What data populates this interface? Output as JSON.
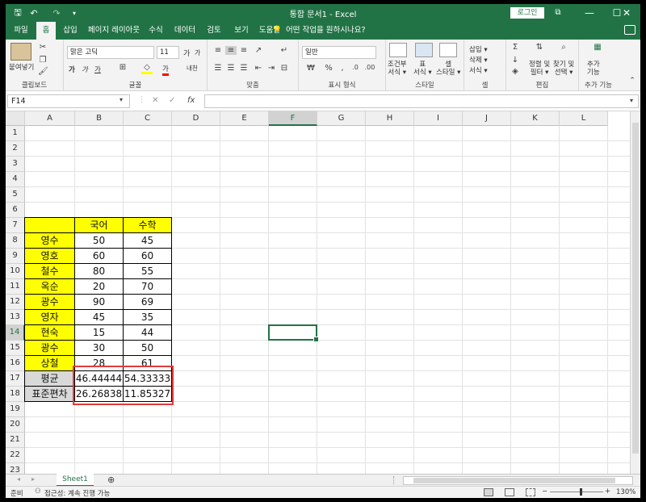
{
  "window": {
    "title": "통합 문서1  -  Excel",
    "login_label": "로그인",
    "qat_save": "🖫",
    "qat_undo": "↶",
    "qat_redo": "↷",
    "qat_more": "▾",
    "restore_icon": "⧉",
    "min_icon": "—",
    "max_icon": "☐",
    "close_icon": "✕"
  },
  "tabs": [
    "파일",
    "홈",
    "삽입",
    "페이지 레이아웃",
    "수식",
    "데이터",
    "검토",
    "보기",
    "도움말"
  ],
  "tell_me": "어떤 작업을 원하시나요?",
  "tell_me_icon": "💡",
  "ribbon": {
    "clipboard": {
      "label": "클립보드",
      "paste": "붙여넣기"
    },
    "font": {
      "label": "글꼴",
      "font_name": "맑은 고딕",
      "font_size": "11",
      "bold": "가",
      "italic": "가",
      "underline": "가",
      "grow": "가",
      "shrink": "가",
      "font_color": "가",
      "phonetic": "내천"
    },
    "alignment": {
      "label": "맞춤"
    },
    "number": {
      "label": "표시 형식",
      "format": "일반"
    },
    "styles": {
      "label": "스타일",
      "conditional": "조건부\n서식 ▾",
      "table": "표\n서식 ▾",
      "cell": "셀\n스타일 ▾"
    },
    "cells": {
      "label": "셀",
      "insert": "삽입 ▾",
      "delete": "삭제 ▾",
      "format": "서식 ▾"
    },
    "editing": {
      "label": "편집",
      "sort": "정렬 및\n필터 ▾",
      "find": "찾기 및\n선택 ▾"
    },
    "addins": {
      "label": "추가 기능",
      "addins": "추가\n기능"
    }
  },
  "formula_bar": {
    "name_box": "F14",
    "cancel": "✕",
    "enter": "✓",
    "fx": "fx",
    "formula": ""
  },
  "grid": {
    "columns": [
      "A",
      "B",
      "C",
      "D",
      "E",
      "F",
      "G",
      "H",
      "I",
      "J",
      "K",
      "L"
    ],
    "rows": [
      "1",
      "2",
      "3",
      "4",
      "5",
      "6",
      "7",
      "8",
      "9",
      "10",
      "11",
      "12",
      "13",
      "14",
      "15",
      "16",
      "17",
      "18",
      "19",
      "20",
      "21",
      "22",
      "23"
    ],
    "selected_cell": "F14",
    "table": {
      "header": [
        "",
        "국어",
        "수학"
      ],
      "students": [
        [
          "영수",
          "50",
          "45"
        ],
        [
          "영호",
          "60",
          "60"
        ],
        [
          "철수",
          "80",
          "55"
        ],
        [
          "옥순",
          "20",
          "70"
        ],
        [
          "광수",
          "90",
          "69"
        ],
        [
          "영자",
          "45",
          "35"
        ],
        [
          "현숙",
          "15",
          "44"
        ],
        [
          "광수",
          "30",
          "50"
        ],
        [
          "상철",
          "28",
          "61"
        ]
      ],
      "stats": [
        [
          "평균",
          "46.44444",
          "54.33333"
        ],
        [
          "표준편차",
          "26.26838",
          "11.85327"
        ]
      ]
    }
  },
  "sheets": {
    "active": "Sheet1",
    "add": "⊕",
    "prev": "◂",
    "next": "▸"
  },
  "status": {
    "ready": "준비",
    "accessibility": "접근성: 계속 진행 가능",
    "zoom": "130%",
    "zoom_minus": "−",
    "zoom_plus": "+"
  },
  "colors": {
    "excel_green": "#217346",
    "yellow": "#ffff00",
    "gray": "#d9d9d9",
    "highlight_red": "#e03c3c"
  }
}
